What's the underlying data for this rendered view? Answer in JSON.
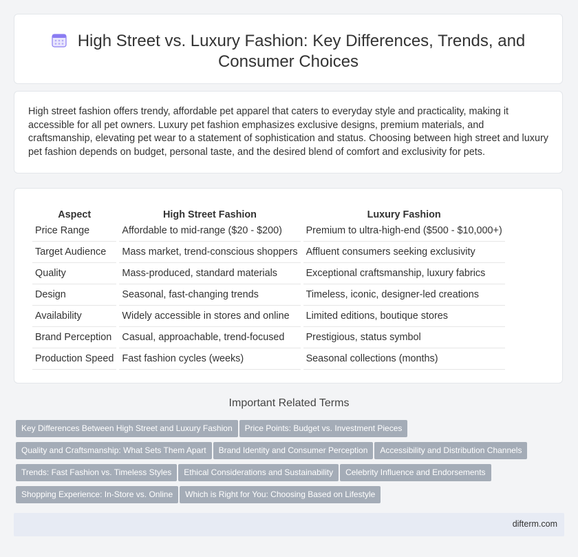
{
  "header": {
    "title": "High Street vs. Luxury Fashion: Key Differences, Trends, and Consumer Choices"
  },
  "summary": "High street fashion offers trendy, affordable pet apparel that caters to everyday style and practicality, making it accessible for all pet owners. Luxury pet fashion emphasizes exclusive designs, premium materials, and craftsmanship, elevating pet wear to a statement of sophistication and status. Choosing between high street and luxury pet fashion depends on budget, personal taste, and the desired blend of comfort and exclusivity for pets.",
  "table": {
    "headers": [
      "Aspect",
      "High Street Fashion",
      "Luxury Fashion"
    ],
    "rows": [
      [
        "Price Range",
        "Affordable to mid-range ($20 - $200)",
        "Premium to ultra-high-end ($500 - $10,000+)"
      ],
      [
        "Target Audience",
        "Mass market, trend-conscious shoppers",
        "Affluent consumers seeking exclusivity"
      ],
      [
        "Quality",
        "Mass-produced, standard materials",
        "Exceptional craftsmanship, luxury fabrics"
      ],
      [
        "Design",
        "Seasonal, fast-changing trends",
        "Timeless, iconic, designer-led creations"
      ],
      [
        "Availability",
        "Widely accessible in stores and online",
        "Limited editions, boutique stores"
      ],
      [
        "Brand Perception",
        "Casual, approachable, trend-focused",
        "Prestigious, status symbol"
      ],
      [
        "Production Speed",
        "Fast fashion cycles (weeks)",
        "Seasonal collections (months)"
      ]
    ]
  },
  "related": {
    "title": "Important Related Terms",
    "tags": [
      "Key Differences Between High Street and Luxury Fashion",
      "Price Points: Budget vs. Investment Pieces",
      "Quality and Craftsmanship: What Sets Them Apart",
      "Brand Identity and Consumer Perception",
      "Accessibility and Distribution Channels",
      "Trends: Fast Fashion vs. Timeless Styles",
      "Ethical Considerations and Sustainability",
      "Celebrity Influence and Endorsements",
      "Shopping Experience: In-Store vs. Online",
      "Which is Right for You: Choosing Based on Lifestyle"
    ]
  },
  "footer": {
    "site": "difterm.com"
  },
  "colors": {
    "accent": "#a4acb7",
    "icon": "#7b6cf0",
    "footer_bg": "#e7ebf4"
  },
  "icons": {
    "title_icon": "calendar-icon"
  }
}
